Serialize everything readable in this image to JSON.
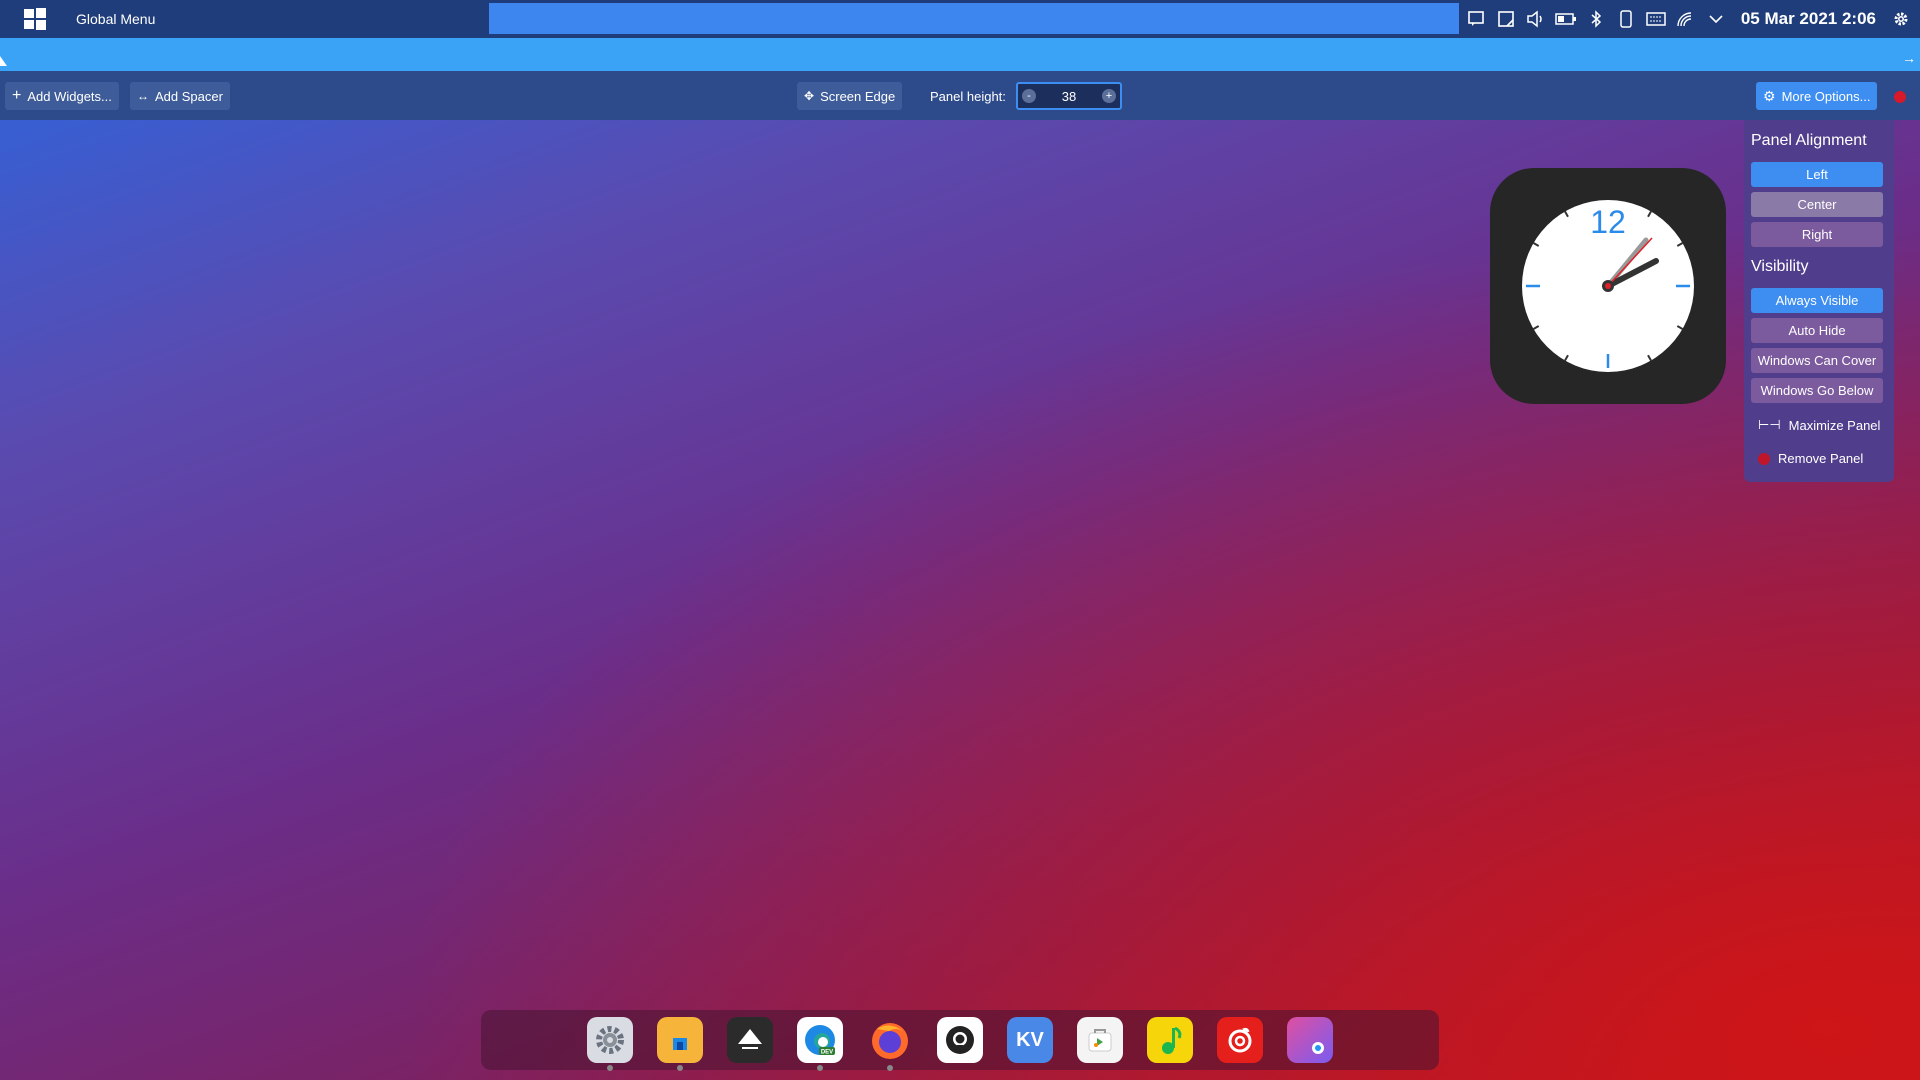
{
  "top_panel": {
    "global_menu_label": "Global Menu",
    "clock_text": "05 Mar 2021 2:06",
    "tray_icons": [
      "notification-icon",
      "clipboard-icon",
      "volume-icon",
      "battery-icon",
      "bluetooth-icon",
      "phone-icon",
      "keyboard-icon",
      "wifi-icon",
      "chevron-down-icon",
      "gear-icon"
    ]
  },
  "toolbar": {
    "add_widgets_label": "Add Widgets...",
    "add_spacer_label": "Add Spacer",
    "screen_edge_label": "Screen Edge",
    "panel_height_label": "Panel height:",
    "panel_height_value": "38",
    "decrement_label": "-",
    "increment_label": "+",
    "more_options_label": "More Options..."
  },
  "options_panel": {
    "alignment_title": "Panel Alignment",
    "alignment_left": "Left",
    "alignment_center": "Center",
    "alignment_right": "Right",
    "visibility_title": "Visibility",
    "always_visible": "Always Visible",
    "auto_hide": "Auto Hide",
    "windows_can_cover": "Windows Can Cover",
    "windows_go_below": "Windows Go Below",
    "maximize_panel": "Maximize Panel",
    "remove_panel": "Remove Panel"
  },
  "clock_widget": {
    "numeral": "12",
    "time": "2:06"
  },
  "dock": {
    "apps": [
      "settings",
      "file-manager",
      "inkscape",
      "edge-dev",
      "firefox",
      "github",
      "kv",
      "app-store",
      "music",
      "netease-music",
      "screenshot"
    ],
    "kv_label": "KV"
  },
  "colors": {
    "accent": "#3d8ef0",
    "panel": "#1e3d7a",
    "toolbar": "#2d4a8a"
  }
}
